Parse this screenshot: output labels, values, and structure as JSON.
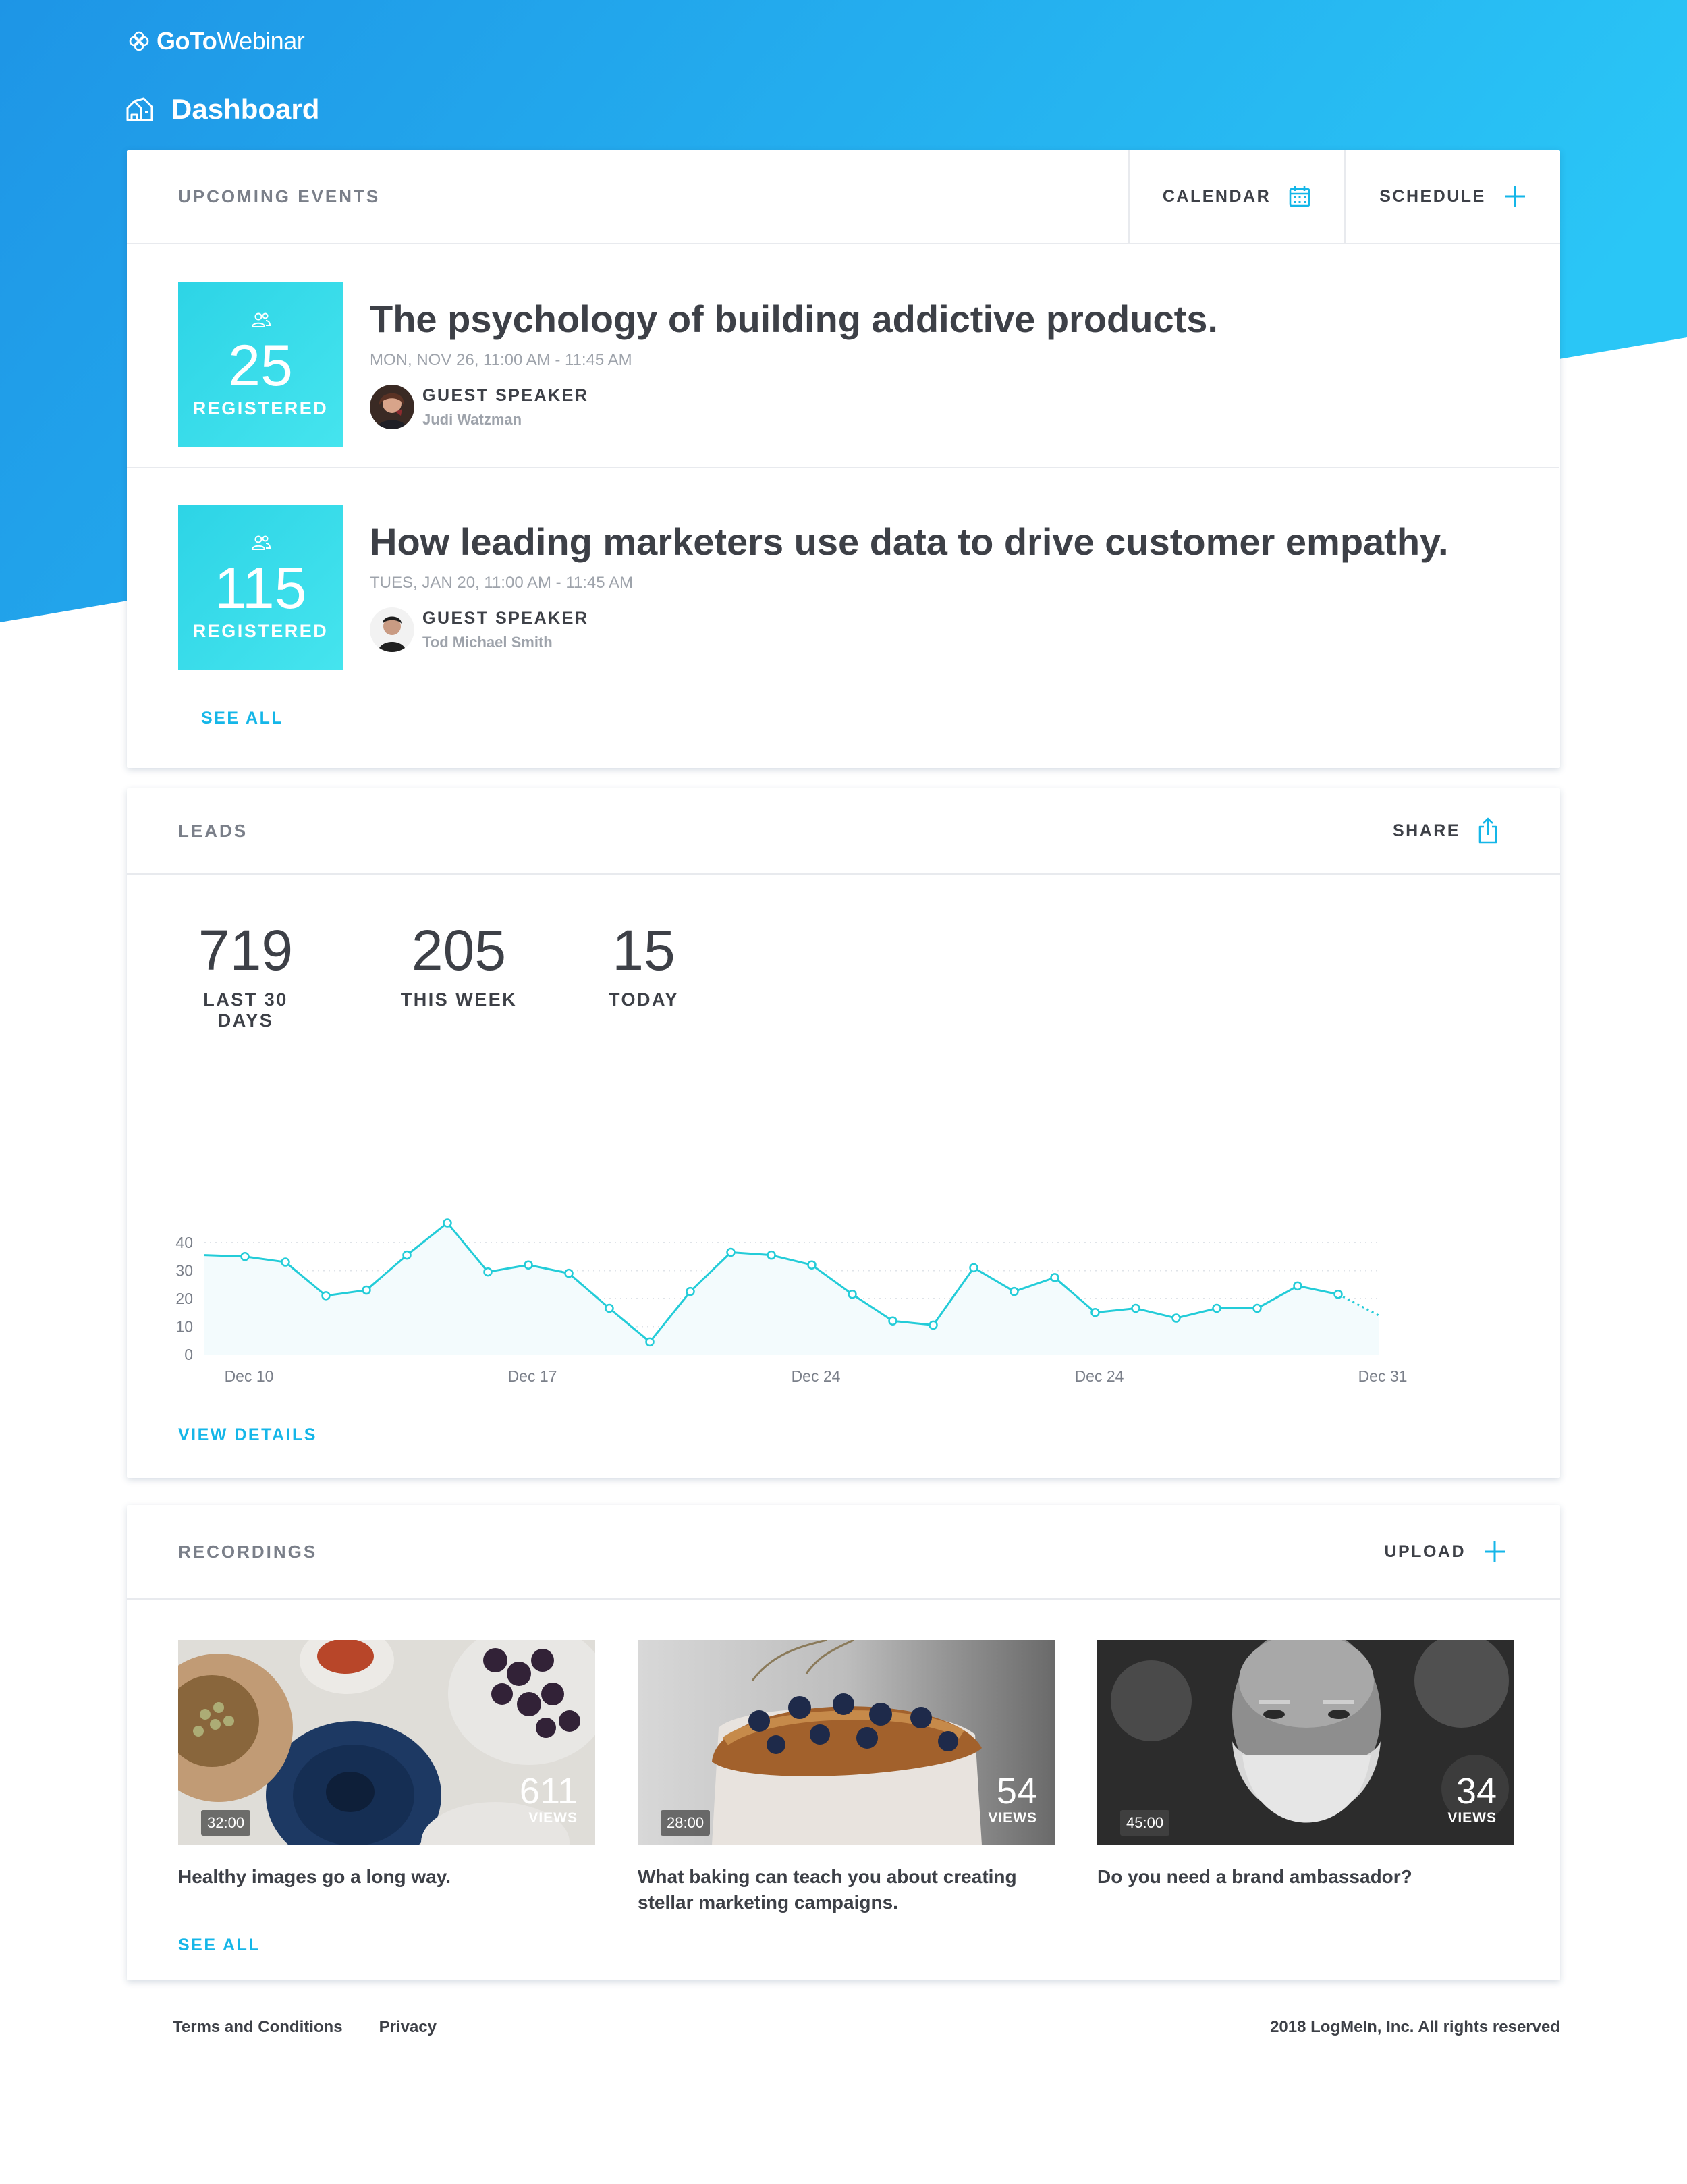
{
  "brand": {
    "logo_bold": "GoTo",
    "logo_light": "Webinar"
  },
  "page": {
    "title": "Dashboard"
  },
  "events": {
    "section_title": "UPCOMING EVENTS",
    "calendar_label": "CALENDAR",
    "schedule_label": "SCHEDULE",
    "see_all": "SEE ALL",
    "items": [
      {
        "registered_count": "25",
        "registered_label": "REGISTERED",
        "title": "The psychology of building addictive products.",
        "datetime": "MON, NOV 26, 11:00 AM - 11:45 AM",
        "speaker_role": "GUEST SPEAKER",
        "speaker_name": "Judi Watzman"
      },
      {
        "registered_count": "115",
        "registered_label": "REGISTERED",
        "title": "How leading marketers use data to drive customer empathy.",
        "datetime": "TUES, JAN 20, 11:00 AM - 11:45 AM",
        "speaker_role": "GUEST SPEAKER",
        "speaker_name": "Tod Michael Smith"
      }
    ]
  },
  "leads": {
    "section_title": "LEADS",
    "share_label": "SHARE",
    "view_details": "VIEW DETAILS",
    "stats": [
      {
        "value": "719",
        "label": "LAST 30 DAYS"
      },
      {
        "value": "205",
        "label": "THIS WEEK"
      },
      {
        "value": "15",
        "label": "TODAY"
      }
    ]
  },
  "chart_data": {
    "type": "area",
    "x": [
      0,
      1,
      2,
      3,
      4,
      5,
      6,
      7,
      8,
      9,
      10,
      11,
      12,
      13,
      14,
      15,
      16,
      17,
      18,
      19,
      20,
      21,
      22,
      23,
      24,
      25,
      26,
      27,
      28,
      29
    ],
    "values": [
      35.5,
      35,
      33,
      21,
      23,
      35.5,
      47,
      29.5,
      32,
      29,
      16.5,
      4.5,
      22.5,
      36.5,
      35.5,
      32,
      21.5,
      12,
      10.5,
      31,
      22.5,
      27.5,
      15,
      16.5,
      13,
      16.5,
      16.5,
      24.5,
      21.5,
      14
    ],
    "projected_from_index": 28,
    "x_ticks": [
      {
        "index": 1,
        "label": "Dec 10"
      },
      {
        "index": 8,
        "label": "Dec 17"
      },
      {
        "index": 15,
        "label": "Dec 24"
      },
      {
        "index": 22,
        "label": "Dec 24"
      },
      {
        "index": 29,
        "label": "Dec 31"
      }
    ],
    "y_ticks": [
      "0",
      "10",
      "20",
      "30",
      "40"
    ],
    "ylim": [
      0,
      40
    ],
    "line_color": "#23ccd8",
    "fill_color": "#f3fbfd",
    "grid": "dotted"
  },
  "recordings": {
    "section_title": "RECORDINGS",
    "upload_label": "UPLOAD",
    "see_all": "SEE ALL",
    "views_label": "VIEWS",
    "items": [
      {
        "duration": "32:00",
        "views": "611",
        "title": "Healthy images go a long way."
      },
      {
        "duration": "28:00",
        "views": "54",
        "title": "What baking can teach you about creating stellar marketing campaigns."
      },
      {
        "duration": "45:00",
        "views": "34",
        "title": "Do you need a brand ambassador?"
      }
    ]
  },
  "footer": {
    "terms": "Terms and Conditions",
    "privacy": "Privacy",
    "copyright": "2018 LogMeIn, Inc. All rights reserved"
  },
  "colors": {
    "hero_start": "#1f9ae8",
    "hero_end": "#27c3f5",
    "accent": "#14b6e8",
    "tile": "#35dae9",
    "text": "#3d4047",
    "muted": "#9ea3ab"
  },
  "icons": [
    "flower-logo-icon",
    "home-icon",
    "calendar-icon",
    "plus-icon",
    "share-icon",
    "people-icon"
  ]
}
